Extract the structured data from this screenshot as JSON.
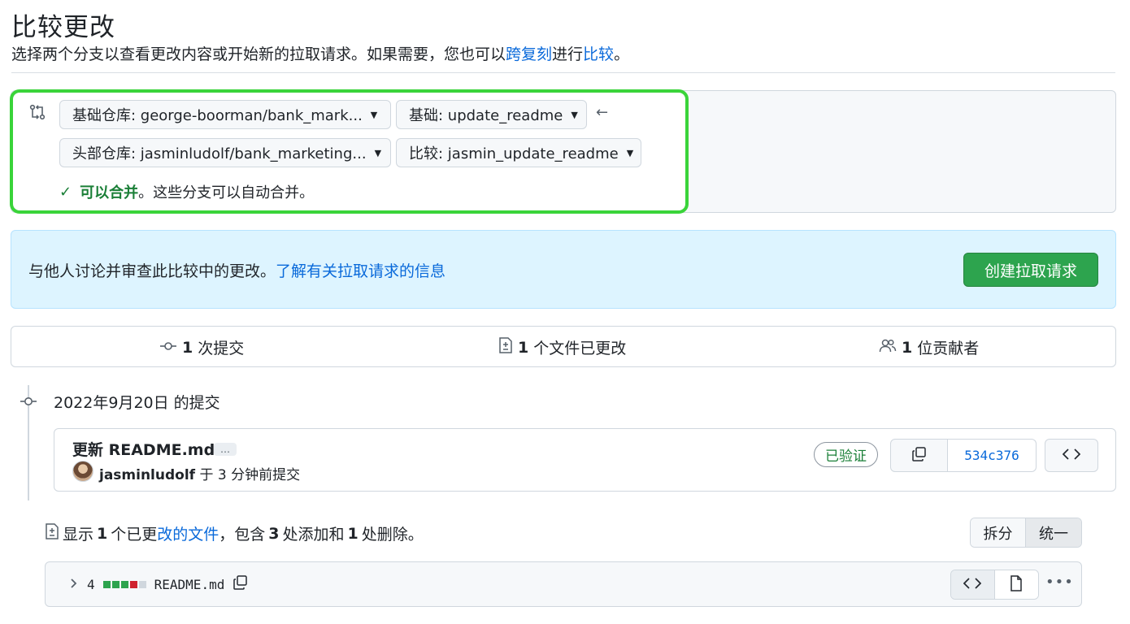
{
  "header": {
    "title": "比较更改",
    "subtitle_prefix": "选择两个分支以查看更改内容或开始新的拉取请求。如果需要，您也可以",
    "subtitle_link1": "跨复刻",
    "subtitle_mid": "进行",
    "subtitle_link2": "比较",
    "subtitle_suffix": "。"
  },
  "range": {
    "base_repo": "基础仓库: george-boorman/bank_mark...",
    "base_branch": "基础: update_readme",
    "head_repo": "头部仓库: jasminludolf/bank_marketing...",
    "compare_branch": "比较: jasmin_update_readme",
    "merge_status_ok": "可以合并",
    "merge_status_text": "。这些分支可以自动合并。"
  },
  "info": {
    "text": "与他人讨论并审查此比较中的更改。",
    "link": "了解有关拉取请求的信息",
    "create_button": "创建拉取请求"
  },
  "stats": {
    "commits_count": "1",
    "commits_label": "次提交",
    "files_count": "1",
    "files_label": "个文件已更改",
    "contributors_count": "1",
    "contributors_label": "位贡献者"
  },
  "timeline": {
    "date_heading": "2022年9月20日 的提交"
  },
  "commit": {
    "title": "更新 README.md",
    "ellipsis": "…",
    "author": "jasminludolf",
    "meta": " 于 3 分钟前提交",
    "verified": "已验证",
    "sha": "534c376"
  },
  "diff_summary": {
    "prefix": "显示",
    "files_count": "1",
    "middle": "个已更",
    "link": "改的文件",
    "comma": "，包含",
    "additions": "3",
    "additions_label": "处添加和",
    "deletions": "1",
    "deletions_label": "处删除。",
    "split": "拆分",
    "unified": "统一"
  },
  "file": {
    "changes": "4",
    "name": "README.md",
    "diffstat": [
      "add",
      "add",
      "add",
      "del",
      "neutral"
    ]
  },
  "colors": {
    "accent": "#0969da",
    "success": "#1a7f37",
    "primary_button": "#2da44e",
    "highlight": "#3ad43a",
    "info_bg": "#ddf4ff",
    "deletion": "#cf222e"
  }
}
